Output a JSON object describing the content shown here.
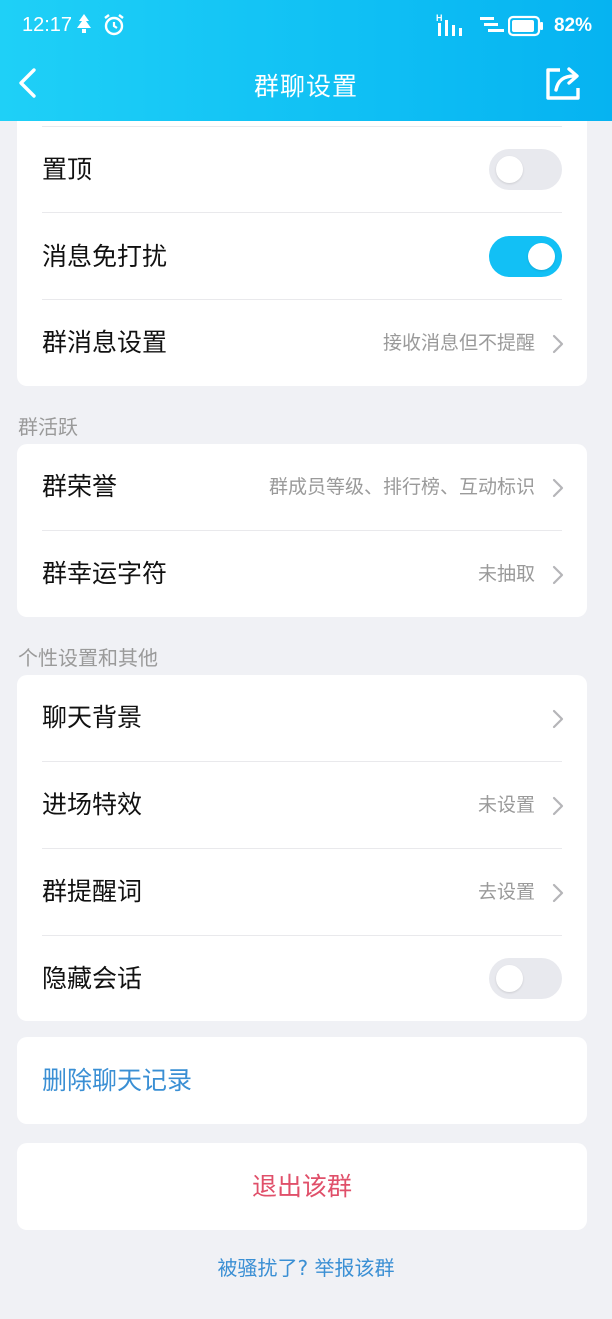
{
  "status": {
    "time": "12:17",
    "battery": "82%"
  },
  "nav": {
    "title": "群聊设置"
  },
  "settings_top": {
    "pin_label": "置顶",
    "pin_on": false,
    "dnd_label": "消息免打扰",
    "dnd_on": true,
    "msg_settings_label": "群消息设置",
    "msg_settings_value": "接收消息但不提醒"
  },
  "activity": {
    "section_title": "群活跃",
    "honor_label": "群荣誉",
    "honor_value": "群成员等级、排行榜、互动标识",
    "lucky_label": "群幸运字符",
    "lucky_value": "未抽取"
  },
  "personal": {
    "section_title": "个性设置和其他",
    "background_label": "聊天背景",
    "entry_effect_label": "进场特效",
    "entry_effect_value": "未设置",
    "reminder_label": "群提醒词",
    "reminder_value": "去设置",
    "hide_label": "隐藏会话",
    "hide_on": false
  },
  "actions": {
    "clear_history": "删除聊天记录",
    "quit_group": "退出该群",
    "report": "被骚扰了? 举报该群"
  },
  "colors": {
    "accent": "#12c0f5",
    "link_blue": "#3a8fd4",
    "danger_red": "#e0506a"
  }
}
